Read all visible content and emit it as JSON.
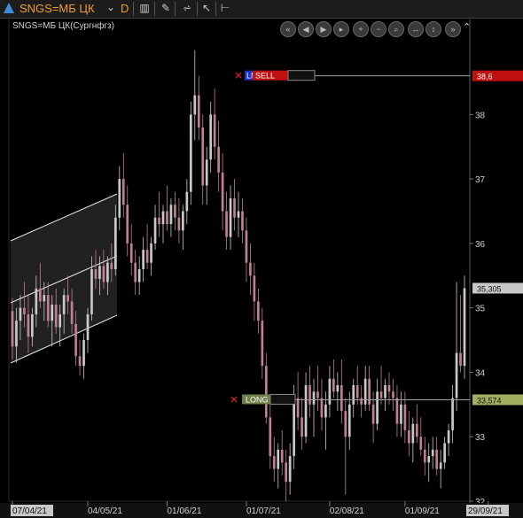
{
  "toolbar": {
    "symbol": "SNGS=МБ ЦК",
    "timeframe": "D",
    "icons": [
      "chart-type-icon",
      "draw-pencil-icon",
      "indicators-icon",
      "cursor-icon",
      "levels-icon"
    ]
  },
  "chart_title": "SNGS=МБ ЦК(Сургнфгз)",
  "nav_icons": [
    "scroll-start-icon",
    "scroll-left-icon",
    "play-icon",
    "scroll-right-icon",
    "zoom-in-icon",
    "zoom-out-icon",
    "search-icon",
    "fit-horizontal-icon",
    "fit-vertical-icon",
    "scroll-end-icon",
    "collapse-icon"
  ],
  "colors": {
    "up": "#c8c8c8",
    "down": "#c08090",
    "sell": "#c01010",
    "long": "#a0b060",
    "lmt": "#2030c0"
  },
  "orders": {
    "sell": {
      "type_label": "LMT",
      "side_label": "SELL",
      "price": 38.6,
      "price_label": "38,6"
    },
    "long": {
      "side_label": "LONG",
      "price": 33.574,
      "price_label": "33,574"
    }
  },
  "last_price_label": "35,305",
  "chart_data": {
    "type": "candlestick",
    "title": "SNGS=МБ ЦК(Сургнфгз)",
    "ylim": [
      32.0,
      39.2
    ],
    "y_ticks": [
      "32",
      "33",
      "34",
      "35",
      "36",
      "37",
      "38"
    ],
    "x_tick_labels": [
      "07/04/21",
      "04/05/21",
      "01/06/21",
      "01/07/21",
      "02/08/21",
      "01/09/21",
      "29/09/21"
    ],
    "x_tick_index": [
      0,
      19,
      39,
      59,
      80,
      99,
      120
    ],
    "last_price": 35.305,
    "ohlc": [
      [
        34.95,
        35.15,
        34.2,
        34.4
      ],
      [
        34.4,
        35.0,
        34.15,
        34.8
      ],
      [
        34.8,
        35.2,
        34.5,
        35.0
      ],
      [
        35.0,
        35.4,
        34.7,
        34.9
      ],
      [
        34.9,
        35.2,
        34.3,
        34.55
      ],
      [
        34.55,
        35.0,
        34.4,
        34.9
      ],
      [
        34.9,
        35.5,
        34.7,
        35.3
      ],
      [
        35.3,
        35.7,
        35.0,
        35.1
      ],
      [
        35.1,
        35.4,
        34.8,
        35.2
      ],
      [
        35.2,
        35.4,
        34.7,
        34.8
      ],
      [
        34.8,
        35.2,
        34.4,
        35.05
      ],
      [
        35.05,
        35.3,
        34.6,
        34.7
      ],
      [
        34.7,
        35.05,
        34.4,
        34.9
      ],
      [
        34.9,
        35.3,
        34.6,
        35.2
      ],
      [
        35.2,
        35.5,
        34.9,
        35.1
      ],
      [
        35.1,
        35.3,
        34.6,
        34.75
      ],
      [
        34.75,
        34.95,
        34.1,
        34.25
      ],
      [
        34.25,
        34.5,
        33.95,
        34.1
      ],
      [
        34.1,
        34.6,
        33.9,
        34.5
      ],
      [
        34.5,
        35.0,
        34.3,
        34.9
      ],
      [
        34.9,
        35.8,
        34.8,
        35.6
      ],
      [
        35.6,
        35.9,
        35.3,
        35.45
      ],
      [
        35.45,
        35.8,
        35.2,
        35.65
      ],
      [
        35.65,
        35.9,
        35.3,
        35.4
      ],
      [
        35.4,
        35.8,
        35.2,
        35.7
      ],
      [
        35.7,
        36.0,
        35.4,
        35.6
      ],
      [
        35.6,
        36.6,
        35.5,
        36.4
      ],
      [
        36.4,
        37.2,
        36.2,
        37.0
      ],
      [
        37.0,
        37.4,
        36.4,
        36.6
      ],
      [
        36.6,
        36.9,
        35.8,
        36.0
      ],
      [
        36.0,
        36.3,
        35.5,
        35.7
      ],
      [
        35.7,
        35.9,
        35.2,
        35.4
      ],
      [
        35.4,
        35.8,
        35.2,
        35.6
      ],
      [
        35.6,
        36.1,
        35.4,
        35.9
      ],
      [
        35.9,
        36.3,
        35.6,
        35.7
      ],
      [
        35.7,
        36.1,
        35.5,
        36.0
      ],
      [
        36.0,
        36.6,
        35.9,
        36.4
      ],
      [
        36.4,
        36.8,
        36.1,
        36.3
      ],
      [
        36.3,
        36.6,
        36.0,
        36.5
      ],
      [
        36.5,
        36.9,
        36.2,
        36.3
      ],
      [
        36.3,
        36.7,
        36.1,
        36.6
      ],
      [
        36.6,
        36.8,
        36.2,
        36.4
      ],
      [
        36.4,
        36.7,
        36.0,
        36.2
      ],
      [
        36.2,
        36.6,
        35.9,
        36.5
      ],
      [
        36.5,
        37.0,
        36.3,
        36.8
      ],
      [
        36.8,
        38.2,
        36.6,
        38.0
      ],
      [
        38.0,
        39.0,
        37.6,
        38.3
      ],
      [
        38.3,
        38.6,
        37.6,
        37.8
      ],
      [
        37.8,
        38.0,
        36.6,
        36.9
      ],
      [
        36.9,
        37.5,
        36.6,
        37.3
      ],
      [
        37.3,
        38.2,
        37.1,
        38.0
      ],
      [
        38.0,
        38.4,
        37.3,
        37.5
      ],
      [
        37.5,
        37.9,
        36.8,
        37.1
      ],
      [
        37.1,
        37.4,
        36.2,
        36.5
      ],
      [
        36.5,
        36.8,
        35.9,
        36.1
      ],
      [
        36.1,
        36.9,
        35.9,
        36.7
      ],
      [
        36.7,
        37.0,
        36.2,
        36.4
      ],
      [
        36.4,
        36.8,
        36.1,
        36.5
      ],
      [
        36.5,
        36.7,
        36.0,
        36.2
      ],
      [
        36.2,
        36.4,
        35.4,
        35.7
      ],
      [
        35.7,
        36.0,
        35.2,
        35.5
      ],
      [
        35.5,
        35.7,
        34.8,
        35.1
      ],
      [
        35.1,
        35.3,
        34.6,
        34.8
      ],
      [
        34.8,
        35.0,
        33.9,
        34.1
      ],
      [
        34.1,
        34.3,
        33.2,
        33.3
      ],
      [
        33.3,
        33.5,
        32.5,
        32.7
      ],
      [
        32.7,
        33.0,
        32.3,
        32.5
      ],
      [
        32.5,
        32.9,
        32.2,
        32.8
      ],
      [
        32.8,
        33.1,
        32.4,
        32.6
      ],
      [
        32.6,
        32.8,
        32.0,
        32.3
      ],
      [
        32.3,
        32.9,
        32.1,
        32.7
      ],
      [
        32.7,
        33.8,
        32.5,
        33.6
      ],
      [
        33.6,
        34.0,
        33.1,
        33.3
      ],
      [
        33.3,
        33.6,
        32.8,
        33.0
      ],
      [
        33.0,
        34.0,
        32.9,
        33.8
      ],
      [
        33.8,
        34.1,
        33.3,
        33.5
      ],
      [
        33.5,
        33.9,
        33.0,
        33.7
      ],
      [
        33.7,
        34.1,
        33.4,
        33.6
      ],
      [
        33.6,
        33.9,
        33.1,
        33.3
      ],
      [
        33.3,
        33.7,
        32.8,
        33.5
      ],
      [
        33.5,
        34.1,
        33.3,
        33.9
      ],
      [
        33.9,
        34.2,
        33.6,
        33.7
      ],
      [
        33.7,
        34.0,
        33.4,
        33.8
      ],
      [
        33.8,
        34.2,
        33.2,
        33.4
      ],
      [
        33.4,
        33.6,
        32.1,
        33.0
      ],
      [
        33.0,
        33.7,
        32.8,
        33.5
      ],
      [
        33.5,
        33.9,
        33.3,
        33.8
      ],
      [
        33.8,
        34.1,
        33.5,
        33.6
      ],
      [
        33.6,
        33.8,
        33.3,
        33.5
      ],
      [
        33.5,
        34.1,
        33.4,
        33.9
      ],
      [
        33.9,
        34.1,
        33.4,
        33.5
      ],
      [
        33.5,
        33.7,
        32.9,
        33.2
      ],
      [
        33.2,
        33.9,
        33.1,
        33.7
      ],
      [
        33.7,
        34.1,
        33.5,
        33.6
      ],
      [
        33.6,
        33.9,
        33.4,
        33.8
      ],
      [
        33.8,
        34.0,
        33.5,
        33.7
      ],
      [
        33.7,
        33.9,
        33.4,
        33.6
      ],
      [
        33.6,
        33.8,
        33.0,
        33.2
      ],
      [
        33.2,
        33.7,
        33.0,
        33.5
      ],
      [
        33.5,
        33.7,
        32.9,
        33.1
      ],
      [
        33.1,
        33.4,
        32.7,
        32.9
      ],
      [
        32.9,
        33.3,
        32.6,
        33.2
      ],
      [
        33.2,
        33.5,
        32.9,
        33.0
      ],
      [
        33.0,
        33.3,
        32.7,
        32.8
      ],
      [
        32.8,
        33.0,
        32.4,
        32.6
      ],
      [
        32.6,
        32.9,
        32.3,
        32.7
      ],
      [
        32.7,
        33.0,
        32.5,
        32.8
      ],
      [
        32.8,
        33.0,
        32.4,
        32.5
      ],
      [
        32.5,
        32.8,
        32.2,
        32.6
      ],
      [
        32.6,
        33.0,
        32.5,
        32.9
      ],
      [
        32.9,
        33.2,
        32.7,
        33.1
      ],
      [
        33.1,
        33.8,
        32.9,
        33.6
      ],
      [
        33.6,
        35.4,
        33.4,
        34.3
      ],
      [
        34.3,
        35.2,
        34.0,
        34.1
      ],
      [
        34.1,
        35.5,
        33.9,
        35.305
      ]
    ]
  }
}
